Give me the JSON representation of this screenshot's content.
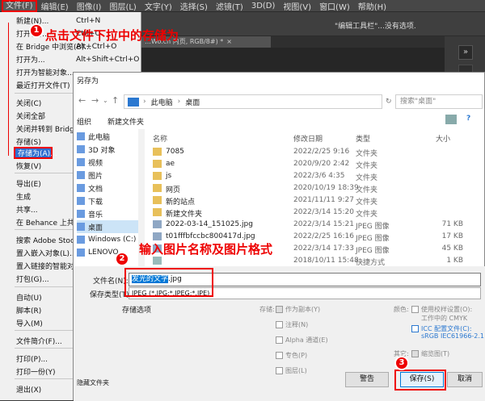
{
  "menubar": [
    "文件(F)",
    "编辑(E)",
    "图像(I)",
    "图层(L)",
    "文字(Y)",
    "选择(S)",
    "滤镜(T)",
    "3D(D)",
    "视图(V)",
    "窗口(W)",
    "帮助(H)"
  ],
  "options_hint": "\"编辑工具栏\"...没有选项.",
  "doc_tab": "…Wo.cn 内页, RGB/8#) *",
  "doc_tab_close": "×",
  "file_menu": {
    "items": [
      {
        "label": "新建(N)...",
        "shortcut": "Ctrl+N"
      },
      {
        "label": "打开(O)...",
        "shortcut": "Ctrl+O"
      },
      {
        "label": "在 Bridge 中浏览(B)...",
        "shortcut": "Alt+Ctrl+O"
      },
      {
        "label": "打开为...",
        "shortcut": "Alt+Shift+Ctrl+O"
      },
      {
        "label": "打开为智能对象...",
        "shortcut": ""
      },
      {
        "label": "最近打开文件(T)",
        "shortcut": ""
      },
      {
        "label": "关闭(C)",
        "shortcut": ""
      },
      {
        "label": "关闭全部",
        "shortcut": ""
      },
      {
        "label": "关闭并转到 Bridge...",
        "shortcut": ""
      },
      {
        "label": "存储(S)",
        "shortcut": ""
      },
      {
        "label": "存储为(A)...",
        "shortcut": ""
      },
      {
        "label": "恢复(V)",
        "shortcut": ""
      },
      {
        "label": "导出(E)",
        "shortcut": ""
      },
      {
        "label": "生成",
        "shortcut": ""
      },
      {
        "label": "共享...",
        "shortcut": ""
      },
      {
        "label": "在 Behance 上共享",
        "shortcut": ""
      },
      {
        "label": "搜索 Adobe Stock...",
        "shortcut": ""
      },
      {
        "label": "置入嵌入对象(L)...",
        "shortcut": ""
      },
      {
        "label": "置入链接的智能对象",
        "shortcut": ""
      },
      {
        "label": "打包(G)...",
        "shortcut": ""
      },
      {
        "label": "自动(U)",
        "shortcut": ""
      },
      {
        "label": "脚本(R)",
        "shortcut": ""
      },
      {
        "label": "导入(M)",
        "shortcut": ""
      },
      {
        "label": "文件简介(F)...",
        "shortcut": ""
      },
      {
        "label": "打印(P)...",
        "shortcut": ""
      },
      {
        "label": "打印一份(Y)",
        "shortcut": ""
      },
      {
        "label": "退出(X)",
        "shortcut": ""
      }
    ]
  },
  "callouts": {
    "step1": "点击文件下拉中的存储为",
    "step2": "输入图片名称及图片格式",
    "n1": "1",
    "n2": "2",
    "n3": "3"
  },
  "dialog": {
    "title": "另存为",
    "breadcrumb": [
      "此电脑",
      "桌面"
    ],
    "search_placeholder": "搜索\"桌面\"",
    "toolbar": {
      "organize": "组织",
      "new_folder": "新建文件夹"
    },
    "tree": [
      "此电脑",
      "3D 对象",
      "视频",
      "图片",
      "文档",
      "下载",
      "音乐",
      "桌面",
      "Windows (C:)",
      "LENOVO"
    ],
    "columns": {
      "name": "名称",
      "date": "修改日期",
      "type": "类型",
      "size": "大小"
    },
    "files": [
      {
        "name": "7085",
        "date": "2022/2/25 9:16",
        "type": "文件夹",
        "size": "",
        "kind": "folder"
      },
      {
        "name": "ae",
        "date": "2020/9/20 2:42",
        "type": "文件夹",
        "size": "",
        "kind": "folder"
      },
      {
        "name": "js",
        "date": "2022/3/6 4:35",
        "type": "文件夹",
        "size": "",
        "kind": "folder"
      },
      {
        "name": "网页",
        "date": "2020/10/19 18:39",
        "type": "文件夹",
        "size": "",
        "kind": "folder"
      },
      {
        "name": "新的站点",
        "date": "2021/11/11 9:27",
        "type": "文件夹",
        "size": "",
        "kind": "folder"
      },
      {
        "name": "新建文件夹",
        "date": "2022/3/14 15:20",
        "type": "文件夹",
        "size": "",
        "kind": "folder"
      },
      {
        "name": "2022-03-14_151025.jpg",
        "date": "2022/3/14 15:21",
        "type": "JPEG 图像",
        "size": "71 KB",
        "kind": "image"
      },
      {
        "name": "t01fffbfccbc800417d.jpg",
        "date": "2022/2/25 16:16",
        "type": "JPEG 图像",
        "size": "17 KB",
        "kind": "image"
      },
      {
        "name": "",
        "date": "2022/3/14 17:33",
        "type": "JPEG 图像",
        "size": "45 KB",
        "kind": "image"
      },
      {
        "name": "",
        "date": "2018/10/11 15:48",
        "type": "快捷方式",
        "size": "1 KB",
        "kind": "link"
      }
    ],
    "filename_label": "文件名(N):",
    "filename_value": "发光的文字.jpg",
    "filetype_label": "保存类型(T):",
    "filetype_value": "JPEG (*.JPG;*.JPEG;*.JPE)",
    "save_options_label": "存储选项",
    "store_label": "存储:",
    "store_options": [
      "作为副本(Y)",
      "注释(N)",
      "Alpha 通道(E)",
      "专色(P)",
      "图层(L)"
    ],
    "color_label": "颜色:",
    "color_options": {
      "proof": "使用校样设置(O):",
      "proof_sub": "工作中的 CMYK",
      "icc": "ICC 配置文件(C):",
      "icc_sub": "sRGB IEC61966-2.1"
    },
    "other_label": "其它:",
    "thumbnail": "缩览图(T)",
    "hide_folders": "隐藏文件夹",
    "buttons": {
      "warning": "警告",
      "save": "保存(S)",
      "cancel": "取消"
    }
  }
}
